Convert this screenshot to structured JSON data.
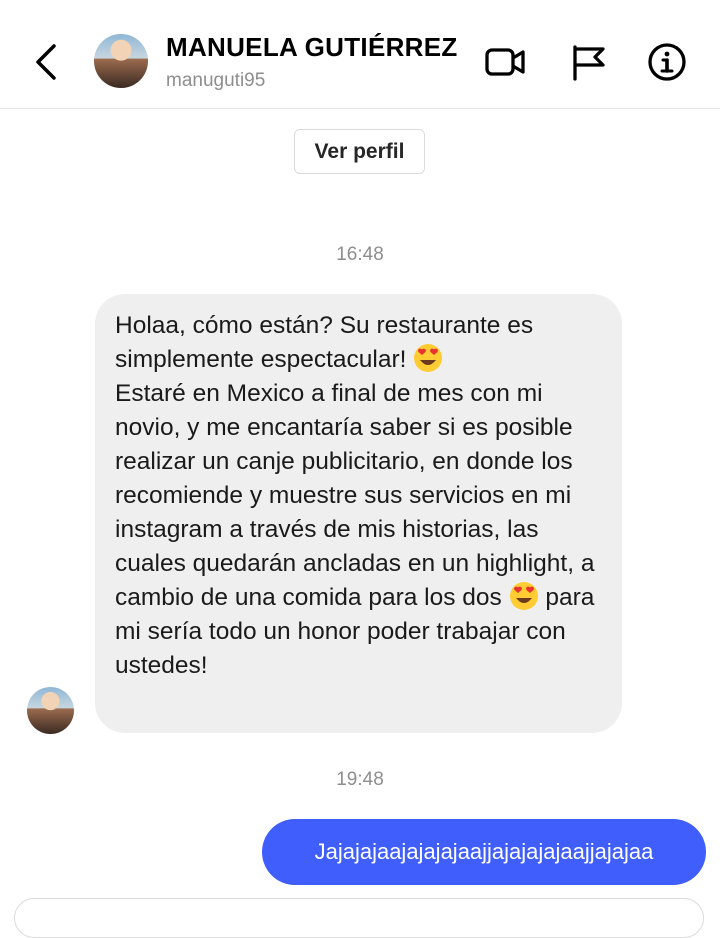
{
  "header": {
    "title": "MANUELA GUTIÉRREZ",
    "username": "manuguti95",
    "icons": [
      "back-chevron-icon",
      "video-call-icon",
      "flag-icon",
      "info-icon"
    ]
  },
  "profile": {
    "button_label": "Ver perfil"
  },
  "messages": [
    {
      "time": "16:48",
      "direction": "incoming",
      "paragraphs": [
        {
          "before": "Holaa, cómo están? Su restaurante es simplemente espectacular! ",
          "emoji": "heart-eyes-emoji",
          "after": ""
        },
        {
          "before": "Estaré en Mexico a final de mes con mi novio, y me encantaría saber si es posible realizar un canje publicitario, en donde los recomiende y muestre sus servicios en mi instagram a través de mis historias, las cuales quedarán ancladas en un highlight, a cambio de una comida para los dos ",
          "emoji": "heart-eyes-emoji",
          "after": " para mi sería todo un honor poder trabajar con ustedes!"
        }
      ]
    },
    {
      "time": "19:48",
      "direction": "outgoing",
      "text": "Jajajajaajajajajaajjajajajajaajjajajaa"
    }
  ],
  "colors": {
    "incoming_bubble": "#efefef",
    "outgoing_bubble": "#3f5efb",
    "secondary_text": "#8e8e8e",
    "divider": "#e6e6e6"
  }
}
